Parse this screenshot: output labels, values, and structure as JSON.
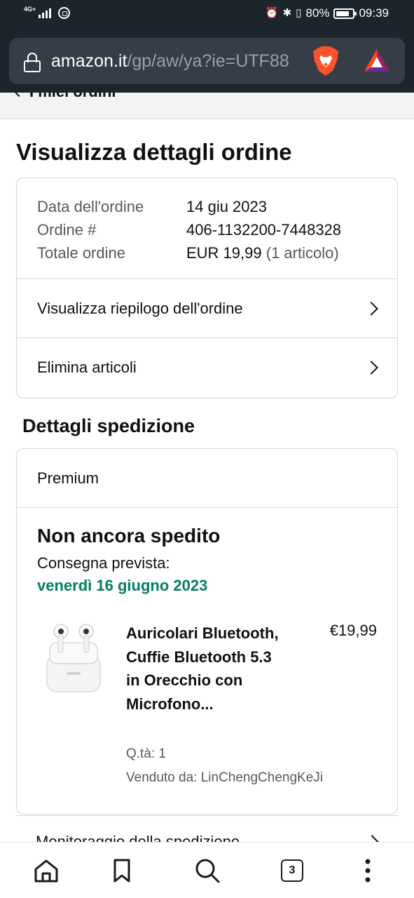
{
  "status_bar": {
    "network": "4G+",
    "battery": "80%",
    "battery_level": 0.8,
    "time": "09:39"
  },
  "url_bar": {
    "domain": "amazon.it",
    "path": "/gp/aw/ya?ie=UTF88"
  },
  "nav_back": {
    "label": "I miei ordini"
  },
  "page_title": "Visualizza dettagli ordine",
  "order_summary": {
    "rows": [
      {
        "label": "Data dell'ordine",
        "value": "14 giu 2023"
      },
      {
        "label": "Ordine #",
        "value": "406-1132200-7448328"
      },
      {
        "label": "Totale ordine",
        "value": "EUR 19,99",
        "extra": "(1 articolo)"
      }
    ],
    "links": [
      {
        "label": "Visualizza riepilogo dell'ordine"
      },
      {
        "label": "Elimina articoli"
      }
    ]
  },
  "shipping": {
    "heading": "Dettagli spedizione",
    "method": "Premium",
    "status": "Non ancora spedito",
    "eta_label": "Consegna prevista:",
    "eta_date": "venerdì 16 giugno 2023",
    "item": {
      "title": "Auricolari Bluetooth, Cuffie Bluetooth 5.3 in Orecchio con Microfono...",
      "price": "€19,99",
      "qty": "Q.tà: 1",
      "seller": "Venduto da: LinChengChengKeJi"
    },
    "tracking_label": "Monitoraggio della spedizione"
  },
  "bottom_nav": {
    "tab_count": "3",
    "icons": [
      "home-icon",
      "bookmark-icon",
      "search-icon",
      "tabs-icon",
      "more-icon"
    ]
  }
}
